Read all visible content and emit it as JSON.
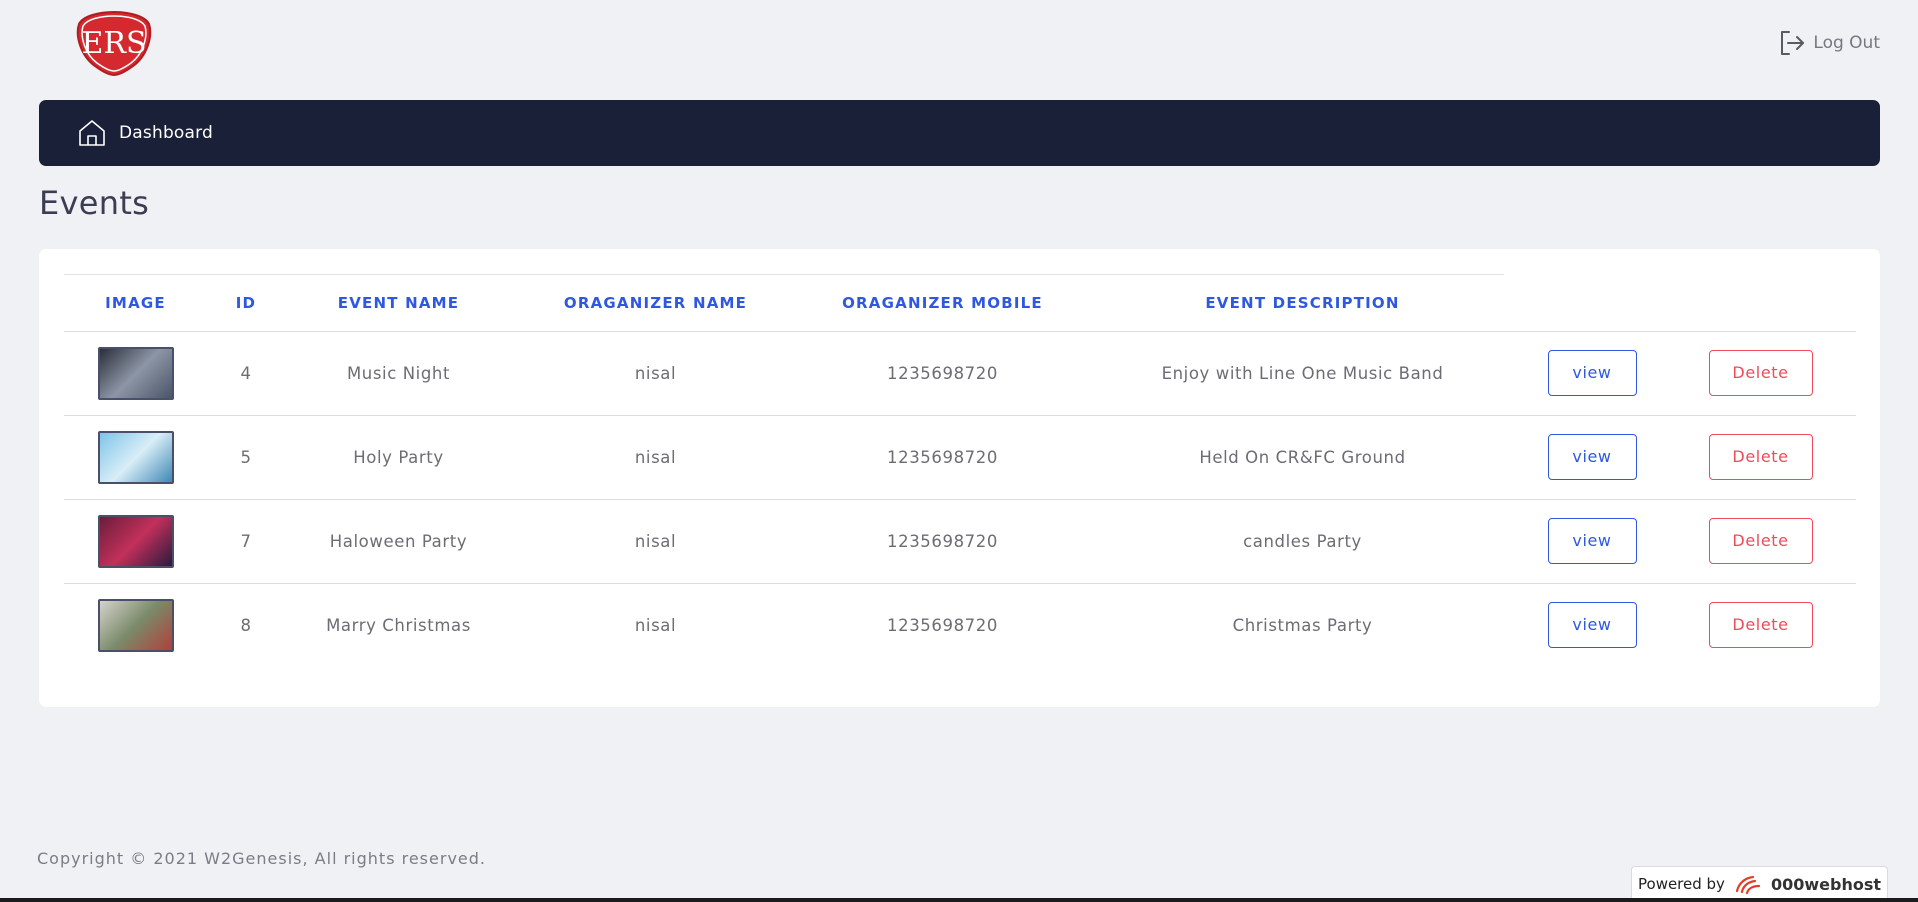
{
  "header": {
    "logo_text": "ERS",
    "logout_label": "Log Out"
  },
  "nav": {
    "items": [
      {
        "label": "Dashboard",
        "icon": "home-icon"
      }
    ]
  },
  "page": {
    "title": "Events"
  },
  "table": {
    "columns": [
      "IMAGE",
      "ID",
      "EVENT NAME",
      "ORAGANIZER NAME",
      "ORAGANIZER MOBILE",
      "EVENT DESCRIPTION"
    ],
    "rows": [
      {
        "id": "4",
        "name": "Music Night",
        "organizer": "nisal",
        "mobile": "1235698720",
        "description": "Enjoy with Line One Music Band",
        "view_label": "view",
        "delete_label": "Delete",
        "thumb_colors": [
          "#2b2f3a",
          "#8d96a6",
          "#4a5568"
        ]
      },
      {
        "id": "5",
        "name": "Holy Party",
        "organizer": "nisal",
        "mobile": "1235698720",
        "description": "Held On CR&FC Ground",
        "view_label": "view",
        "delete_label": "Delete",
        "thumb_colors": [
          "#7fc4e8",
          "#d9eef8",
          "#3f88b5"
        ]
      },
      {
        "id": "7",
        "name": "Haloween Party",
        "organizer": "nisal",
        "mobile": "1235698720",
        "description": "candles Party",
        "view_label": "view",
        "delete_label": "Delete",
        "thumb_colors": [
          "#6b1d3a",
          "#c2305a",
          "#2b1a3f"
        ]
      },
      {
        "id": "8",
        "name": "Marry Christmas",
        "organizer": "nisal",
        "mobile": "1235698720",
        "description": "Christmas Party",
        "view_label": "view",
        "delete_label": "Delete",
        "thumb_colors": [
          "#d6d2cc",
          "#7a8a6a",
          "#b0403a"
        ]
      }
    ]
  },
  "footer": {
    "copyright": "Copyright © 2021 W2Genesis, All rights reserved.",
    "powered_by": "Powered by",
    "host": "000webhost"
  },
  "colors": {
    "navbar": "#1b2039",
    "accent_blue": "#2f58e0",
    "danger_red": "#ee4b5b",
    "background": "#f0f1f4"
  }
}
